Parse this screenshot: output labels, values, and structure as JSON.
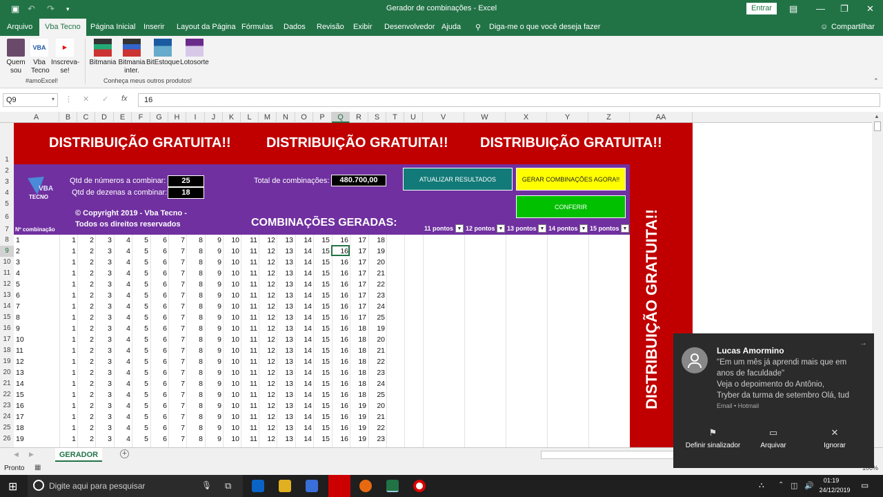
{
  "window": {
    "title": "Gerador de combinações  -  Excel",
    "signin": "Entrar"
  },
  "menu": [
    "Arquivo",
    "Vba Tecno",
    "Página Inicial",
    "Inserir",
    "Layout da Página",
    "Fórmulas",
    "Dados",
    "Revisão",
    "Exibir",
    "Desenvolvedor",
    "Ajuda"
  ],
  "tell_me": "Diga-me o que você deseja fazer",
  "share": "Compartilhar",
  "ribbon": {
    "btn1": "Quem sou",
    "btn2": "Vba Tecno",
    "btn3": "Inscreva-se!",
    "group1": "#amoExcel!",
    "btn4": "Bitmania",
    "btn5": "Bitmania inter.",
    "btn6": "BitEstoque",
    "btn7": "Lotosorte",
    "group2": "Conheça meus outros produtos!"
  },
  "formula": {
    "namebox": "Q9",
    "value": "16"
  },
  "columns": [
    "A",
    "B",
    "C",
    "D",
    "E",
    "F",
    "G",
    "H",
    "I",
    "J",
    "K",
    "L",
    "M",
    "N",
    "O",
    "P",
    "Q",
    "R",
    "S",
    "T",
    "U",
    "V",
    "W",
    "X",
    "Y",
    "Z",
    "AA"
  ],
  "banner": {
    "text1": "DISTRIBUIÇÃO GRATUITA!!",
    "text2": "DISTRIBUIÇÃO GRATUITA!!",
    "text3": "DISTRIBUIÇÃO GRATUITA!!",
    "vertical": "DISTRIBUIÇÃO GRATUITA!!"
  },
  "panel": {
    "qtd_numeros_label": "Qtd de números a combinar:",
    "qtd_numeros": "25",
    "qtd_dezenas_label": "Qtd de dezenas a combinar:",
    "qtd_dezenas": "18",
    "total_label": "Total de combinações:",
    "total": "480.700,00",
    "copyright1": "© Copyright 2019 - Vba Tecno -",
    "copyright2": "Todos os direitos reservados",
    "btn_atualizar": "ATUALIZAR RESULTADOS",
    "btn_gerar": "GERAR COMBINAÇÕES AGORA!!",
    "btn_conferir": "CONFERIR",
    "comb_title": "COMBINAÇÕES GERADAS:",
    "ncomb_header": "Nº combinação",
    "filters": [
      "11 pontos",
      "12 pontos",
      "13 pontos",
      "14 pontos",
      "15 pontos"
    ],
    "colors": {
      "purple": "#7030a0",
      "red": "#c00000",
      "teal": "#127a78",
      "yellow": "#ffff00",
      "green": "#00c000"
    }
  },
  "row_numbers": [
    "1",
    "2",
    "3",
    "4",
    "5",
    "6",
    "7",
    "8",
    "9",
    "10",
    "11",
    "12",
    "13",
    "14",
    "15",
    "16",
    "17",
    "18",
    "19",
    "20",
    "21",
    "22",
    "23",
    "24",
    "25",
    "26"
  ],
  "rows": [
    {
      "n": "1",
      "v": [
        "1",
        "2",
        "3",
        "4",
        "5",
        "6",
        "7",
        "8",
        "9",
        "10",
        "11",
        "12",
        "13",
        "14",
        "15",
        "16",
        "17",
        "18"
      ]
    },
    {
      "n": "2",
      "v": [
        "1",
        "2",
        "3",
        "4",
        "5",
        "6",
        "7",
        "8",
        "9",
        "10",
        "11",
        "12",
        "13",
        "14",
        "15",
        "16",
        "17",
        "19"
      ]
    },
    {
      "n": "3",
      "v": [
        "1",
        "2",
        "3",
        "4",
        "5",
        "6",
        "7",
        "8",
        "9",
        "10",
        "11",
        "12",
        "13",
        "14",
        "15",
        "16",
        "17",
        "20"
      ]
    },
    {
      "n": "4",
      "v": [
        "1",
        "2",
        "3",
        "4",
        "5",
        "6",
        "7",
        "8",
        "9",
        "10",
        "11",
        "12",
        "13",
        "14",
        "15",
        "16",
        "17",
        "21"
      ]
    },
    {
      "n": "5",
      "v": [
        "1",
        "2",
        "3",
        "4",
        "5",
        "6",
        "7",
        "8",
        "9",
        "10",
        "11",
        "12",
        "13",
        "14",
        "15",
        "16",
        "17",
        "22"
      ]
    },
    {
      "n": "6",
      "v": [
        "1",
        "2",
        "3",
        "4",
        "5",
        "6",
        "7",
        "8",
        "9",
        "10",
        "11",
        "12",
        "13",
        "14",
        "15",
        "16",
        "17",
        "23"
      ]
    },
    {
      "n": "7",
      "v": [
        "1",
        "2",
        "3",
        "4",
        "5",
        "6",
        "7",
        "8",
        "9",
        "10",
        "11",
        "12",
        "13",
        "14",
        "15",
        "16",
        "17",
        "24"
      ]
    },
    {
      "n": "8",
      "v": [
        "1",
        "2",
        "3",
        "4",
        "5",
        "6",
        "7",
        "8",
        "9",
        "10",
        "11",
        "12",
        "13",
        "14",
        "15",
        "16",
        "17",
        "25"
      ]
    },
    {
      "n": "9",
      "v": [
        "1",
        "2",
        "3",
        "4",
        "5",
        "6",
        "7",
        "8",
        "9",
        "10",
        "11",
        "12",
        "13",
        "14",
        "15",
        "16",
        "18",
        "19"
      ]
    },
    {
      "n": "10",
      "v": [
        "1",
        "2",
        "3",
        "4",
        "5",
        "6",
        "7",
        "8",
        "9",
        "10",
        "11",
        "12",
        "13",
        "14",
        "15",
        "16",
        "18",
        "20"
      ]
    },
    {
      "n": "11",
      "v": [
        "1",
        "2",
        "3",
        "4",
        "5",
        "6",
        "7",
        "8",
        "9",
        "10",
        "11",
        "12",
        "13",
        "14",
        "15",
        "16",
        "18",
        "21"
      ]
    },
    {
      "n": "12",
      "v": [
        "1",
        "2",
        "3",
        "4",
        "5",
        "6",
        "7",
        "8",
        "9",
        "10",
        "11",
        "12",
        "13",
        "14",
        "15",
        "16",
        "18",
        "22"
      ]
    },
    {
      "n": "13",
      "v": [
        "1",
        "2",
        "3",
        "4",
        "5",
        "6",
        "7",
        "8",
        "9",
        "10",
        "11",
        "12",
        "13",
        "14",
        "15",
        "16",
        "18",
        "23"
      ]
    },
    {
      "n": "14",
      "v": [
        "1",
        "2",
        "3",
        "4",
        "5",
        "6",
        "7",
        "8",
        "9",
        "10",
        "11",
        "12",
        "13",
        "14",
        "15",
        "16",
        "18",
        "24"
      ]
    },
    {
      "n": "15",
      "v": [
        "1",
        "2",
        "3",
        "4",
        "5",
        "6",
        "7",
        "8",
        "9",
        "10",
        "11",
        "12",
        "13",
        "14",
        "15",
        "16",
        "18",
        "25"
      ]
    },
    {
      "n": "16",
      "v": [
        "1",
        "2",
        "3",
        "4",
        "5",
        "6",
        "7",
        "8",
        "9",
        "10",
        "11",
        "12",
        "13",
        "14",
        "15",
        "16",
        "19",
        "20"
      ]
    },
    {
      "n": "17",
      "v": [
        "1",
        "2",
        "3",
        "4",
        "5",
        "6",
        "7",
        "8",
        "9",
        "10",
        "11",
        "12",
        "13",
        "14",
        "15",
        "16",
        "19",
        "21"
      ]
    },
    {
      "n": "18",
      "v": [
        "1",
        "2",
        "3",
        "4",
        "5",
        "6",
        "7",
        "8",
        "9",
        "10",
        "11",
        "12",
        "13",
        "14",
        "15",
        "16",
        "19",
        "22"
      ]
    },
    {
      "n": "19",
      "v": [
        "1",
        "2",
        "3",
        "4",
        "5",
        "6",
        "7",
        "8",
        "9",
        "10",
        "11",
        "12",
        "13",
        "14",
        "15",
        "16",
        "19",
        "23"
      ]
    }
  ],
  "sheet_tab": "GERADOR",
  "status": "Pronto",
  "zoom": "100%",
  "taskbar": {
    "search": "Digite aqui para pesquisar",
    "time": "01:19",
    "date": "24/12/2019"
  },
  "toast": {
    "sender": "Lucas Amormino",
    "line1": "\"Em um mês já aprendi mais que em",
    "line2": "anos de faculdade\"",
    "line3": "Veja o depoimento do Antônio,",
    "line4": "Tryber da turma de setembro Olá, tud",
    "source": "Email • Hotmail",
    "action1": "Definir sinalizador",
    "action2": "Arquivar",
    "action3": "Ignorar"
  }
}
